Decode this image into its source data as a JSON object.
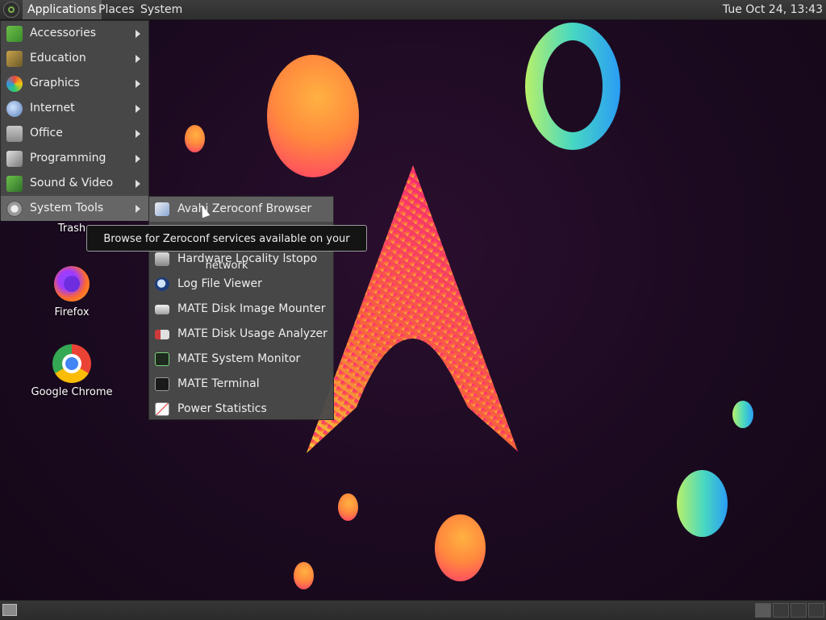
{
  "top_panel": {
    "menus": [
      "Applications",
      "Places",
      "System"
    ],
    "clock": "Tue Oct 24, 13:43"
  },
  "applications_menu": {
    "items": [
      {
        "label": "Accessories",
        "icon": "accessories-icon"
      },
      {
        "label": "Education",
        "icon": "education-icon"
      },
      {
        "label": "Graphics",
        "icon": "graphics-icon"
      },
      {
        "label": "Internet",
        "icon": "internet-icon"
      },
      {
        "label": "Office",
        "icon": "office-icon"
      },
      {
        "label": "Programming",
        "icon": "programming-icon"
      },
      {
        "label": "Sound & Video",
        "icon": "sound-video-icon"
      },
      {
        "label": "System Tools",
        "icon": "system-tools-icon"
      }
    ]
  },
  "system_tools_menu": {
    "items": [
      {
        "label": "Avahi Zeroconf Browser",
        "icon": "avahi-icon"
      },
      {
        "label": "Hardware Locality lstopo",
        "icon": "hardware-icon"
      },
      {
        "label": "Log File Viewer",
        "icon": "log-viewer-icon"
      },
      {
        "label": "MATE Disk Image Mounter",
        "icon": "disk-mounter-icon"
      },
      {
        "label": "MATE Disk Usage Analyzer",
        "icon": "disk-usage-icon"
      },
      {
        "label": "MATE System Monitor",
        "icon": "system-monitor-icon"
      },
      {
        "label": "MATE Terminal",
        "icon": "terminal-icon"
      },
      {
        "label": "Power Statistics",
        "icon": "power-stats-icon"
      }
    ]
  },
  "tooltip": "Browse for Zeroconf services available on your network",
  "desktop_icons": [
    {
      "label": "Trash",
      "icon": "trash-icon"
    },
    {
      "label": "Firefox",
      "icon": "firefox-icon"
    },
    {
      "label": "Google Chrome",
      "icon": "chrome-icon"
    }
  ],
  "colors": {
    "panel": "#2e2e2e",
    "menu_bg": "#4a4a4a",
    "highlight": "#666666",
    "wallpaper": "#1b0a20",
    "accent_orange": "#ff8a3d",
    "accent_pink": "#ff2a6d"
  }
}
